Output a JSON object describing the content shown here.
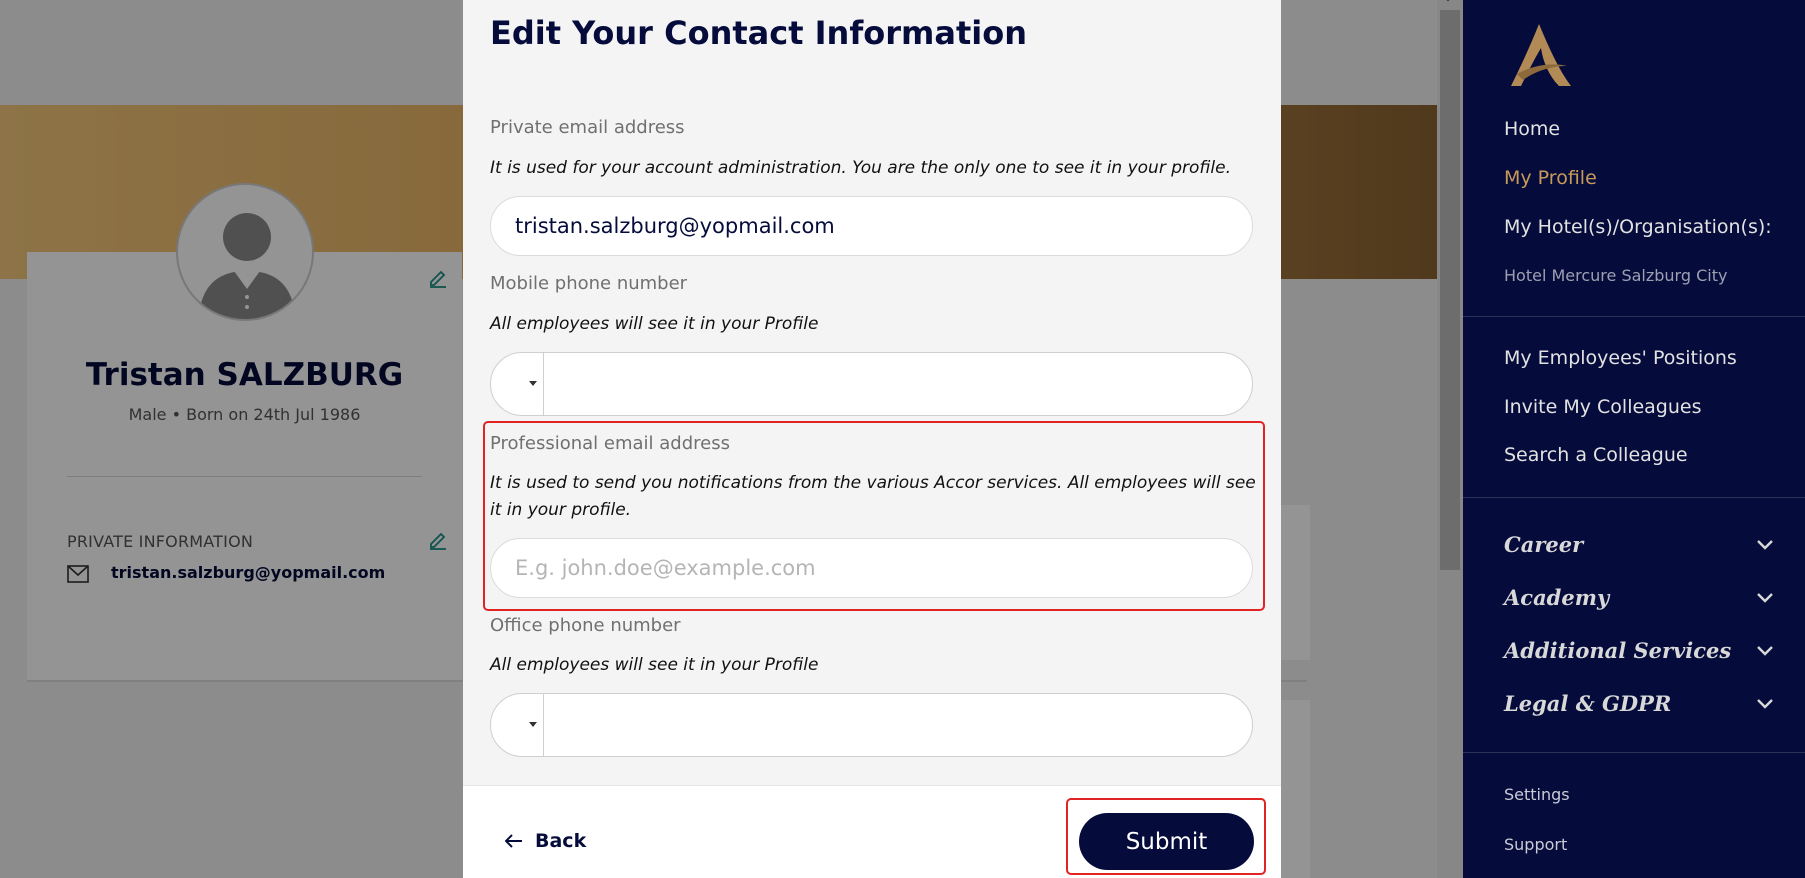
{
  "profile": {
    "name": "Tristan SALZBURG",
    "subtitle": "Male • Born on 24th Jul 1986",
    "private_section_title": "PRIVATE INFORMATION",
    "private_email": "tristan.salzburg@yopmail.com"
  },
  "modal": {
    "title": "Edit Your Contact Information",
    "private_email": {
      "label": "Private email address",
      "help": "It is used for your account administration. You are the only one to see it in your profile.",
      "value": "tristan.salzburg@yopmail.com"
    },
    "mobile_phone": {
      "label": "Mobile phone number",
      "help": "All employees will see it in your Profile",
      "value": ""
    },
    "professional_email": {
      "label": "Professional email address",
      "help": "It is used to send you notifications from the various Accor services. All employees will see it in your profile.",
      "placeholder": "E.g. john.doe@example.com",
      "value": ""
    },
    "office_phone": {
      "label": "Office phone number",
      "help": "All employees will see it in your Profile",
      "value": ""
    },
    "back_label": "Back",
    "submit_label": "Submit"
  },
  "sidebar": {
    "links": {
      "home": "Home",
      "my_profile": "My Profile",
      "my_hotels": "My Hotel(s)/Organisation(s):",
      "hotel_name": "Hotel Mercure Salzburg City",
      "employees_positions": "My Employees' Positions",
      "invite": "Invite My Colleagues",
      "search": "Search a Colleague",
      "settings": "Settings",
      "support": "Support"
    },
    "sections": [
      "Career",
      "Academy",
      "Additional Services",
      "Legal & GDPR"
    ]
  },
  "colors": {
    "navy": "#050b3a",
    "gold": "#c89a5a",
    "highlight": "#e02424"
  }
}
